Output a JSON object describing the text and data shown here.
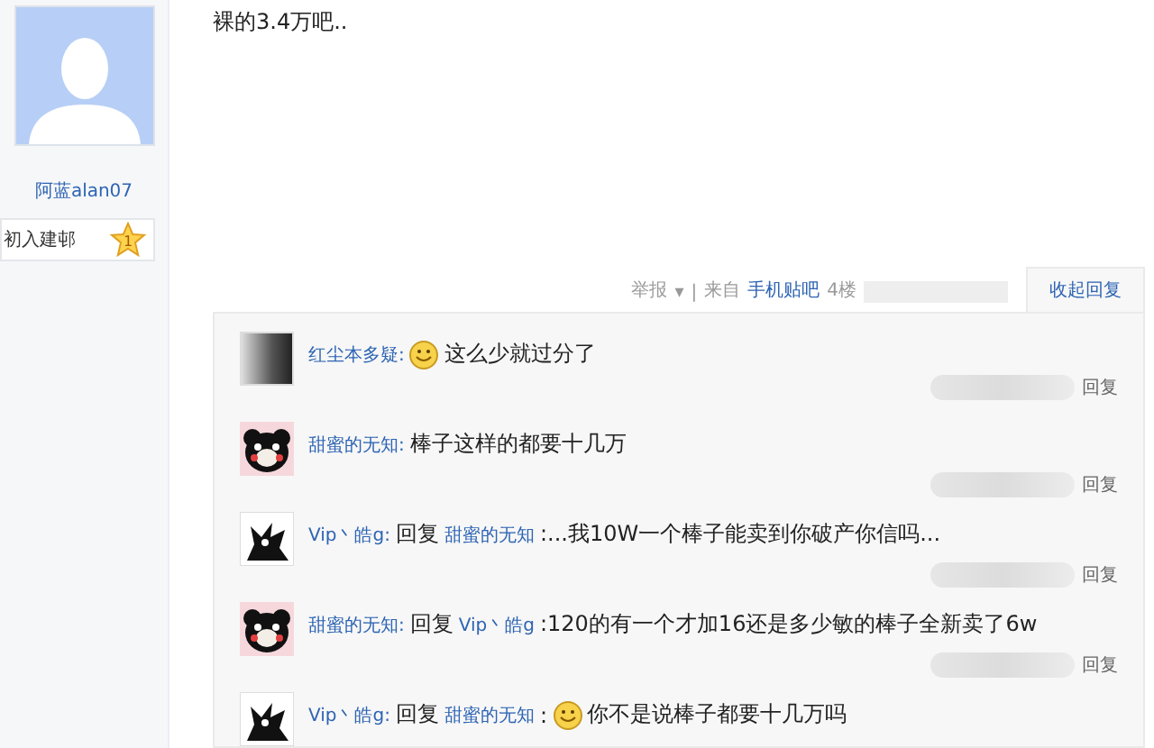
{
  "author": {
    "name": "阿蓝alan07",
    "rank": "初入建邨",
    "level": "1"
  },
  "post": {
    "text": "裸的3.4万吧..",
    "actions": {
      "report": "举报",
      "caret": "▾",
      "separator": "|",
      "source_prefix": "来自",
      "source": "手机贴吧",
      "floor": "4楼"
    },
    "collapse_tab": "收起回复"
  },
  "replies": [
    {
      "kind": "photo",
      "author": "红尘本多疑:",
      "content": [
        {
          "kind": "emoticon"
        },
        {
          "kind": "text",
          "text": "这么少就过分了"
        }
      ],
      "reply_link": "回复"
    },
    {
      "kind": "bear",
      "author": "甜蜜的无知:",
      "content": [
        {
          "kind": "text",
          "text": "棒子这样的都要十几万"
        }
      ],
      "reply_link": "回复"
    },
    {
      "kind": "creature",
      "author": "Vip丶皓g:",
      "content": [
        {
          "kind": "text",
          "text": "回复"
        },
        {
          "kind": "user",
          "text": "甜蜜的无知"
        },
        {
          "kind": "text",
          "text": ":...我10W一个棒子能卖到你破产你信吗..."
        }
      ],
      "reply_link": "回复"
    },
    {
      "kind": "bear",
      "author": "甜蜜的无知:",
      "content": [
        {
          "kind": "text",
          "text": "回复"
        },
        {
          "kind": "user",
          "text": "Vip丶皓g"
        },
        {
          "kind": "text",
          "text": ":120的有一个才加16还是多少敏的棒子全新卖了6w"
        }
      ],
      "reply_link": "回复"
    },
    {
      "kind": "creature",
      "author": "Vip丶皓g:",
      "content": [
        {
          "kind": "text",
          "text": "回复"
        },
        {
          "kind": "user",
          "text": "甜蜜的无知"
        },
        {
          "kind": "text",
          "text": ":"
        },
        {
          "kind": "emoticon"
        },
        {
          "kind": "text",
          "text": "你不是说棒子都要十几万吗"
        }
      ]
    }
  ]
}
